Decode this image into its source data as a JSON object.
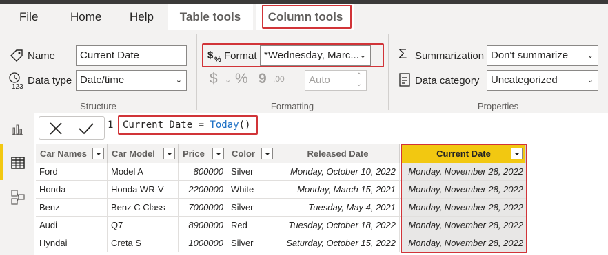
{
  "menu": {
    "tabs": [
      "File",
      "Home",
      "Help",
      "Table tools",
      "Column tools"
    ]
  },
  "ribbon": {
    "structure": {
      "name_label": "Name",
      "name_value": "Current Date",
      "datatype_label": "Data type",
      "datatype_value": "Date/time",
      "title": "Structure"
    },
    "formatting": {
      "format_label": "Format",
      "format_value": "*Wednesday, Marc...",
      "currency_symbol": "$",
      "percent_symbol": "%",
      "comma_symbol": "9",
      "decimal_symbol": ".00",
      "auto_value": "Auto",
      "title": "Formatting"
    },
    "properties": {
      "summarization_label": "Summarization",
      "summarization_value": "Don't summarize",
      "category_label": "Data category",
      "category_value": "Uncategorized",
      "title": "Properties"
    }
  },
  "formula": {
    "line_number": "1",
    "prefix": "Current Date = ",
    "function": "Today",
    "suffix": "()"
  },
  "table": {
    "columns": [
      "Car Names",
      "Car Model",
      "Price",
      "Color",
      "Released Date",
      "Current Date"
    ],
    "rows": [
      [
        "Ford",
        "Model A",
        "800000",
        "Silver",
        "Monday, October 10, 2022",
        "Monday, November 28, 2022"
      ],
      [
        "Honda",
        "Honda WR-V",
        "2200000",
        "White",
        "Monday, March 15, 2021",
        "Monday, November 28, 2022"
      ],
      [
        "Benz",
        "Benz C Class",
        "7000000",
        "Silver",
        "Tuesday, May 4, 2021",
        "Monday, November 28, 2022"
      ],
      [
        "Audi",
        "Q7",
        "8900000",
        "Red",
        "Tuesday, October 18, 2022",
        "Monday, November 28, 2022"
      ],
      [
        "Hyndai",
        "Creta S",
        "1000000",
        "Silver",
        "Saturday, October 15, 2022",
        "Monday, November 28, 2022"
      ]
    ]
  },
  "colors": {
    "accent_yellow": "#f2c811",
    "highlight_red": "#d13438",
    "function_blue": "#1a6ec4"
  }
}
